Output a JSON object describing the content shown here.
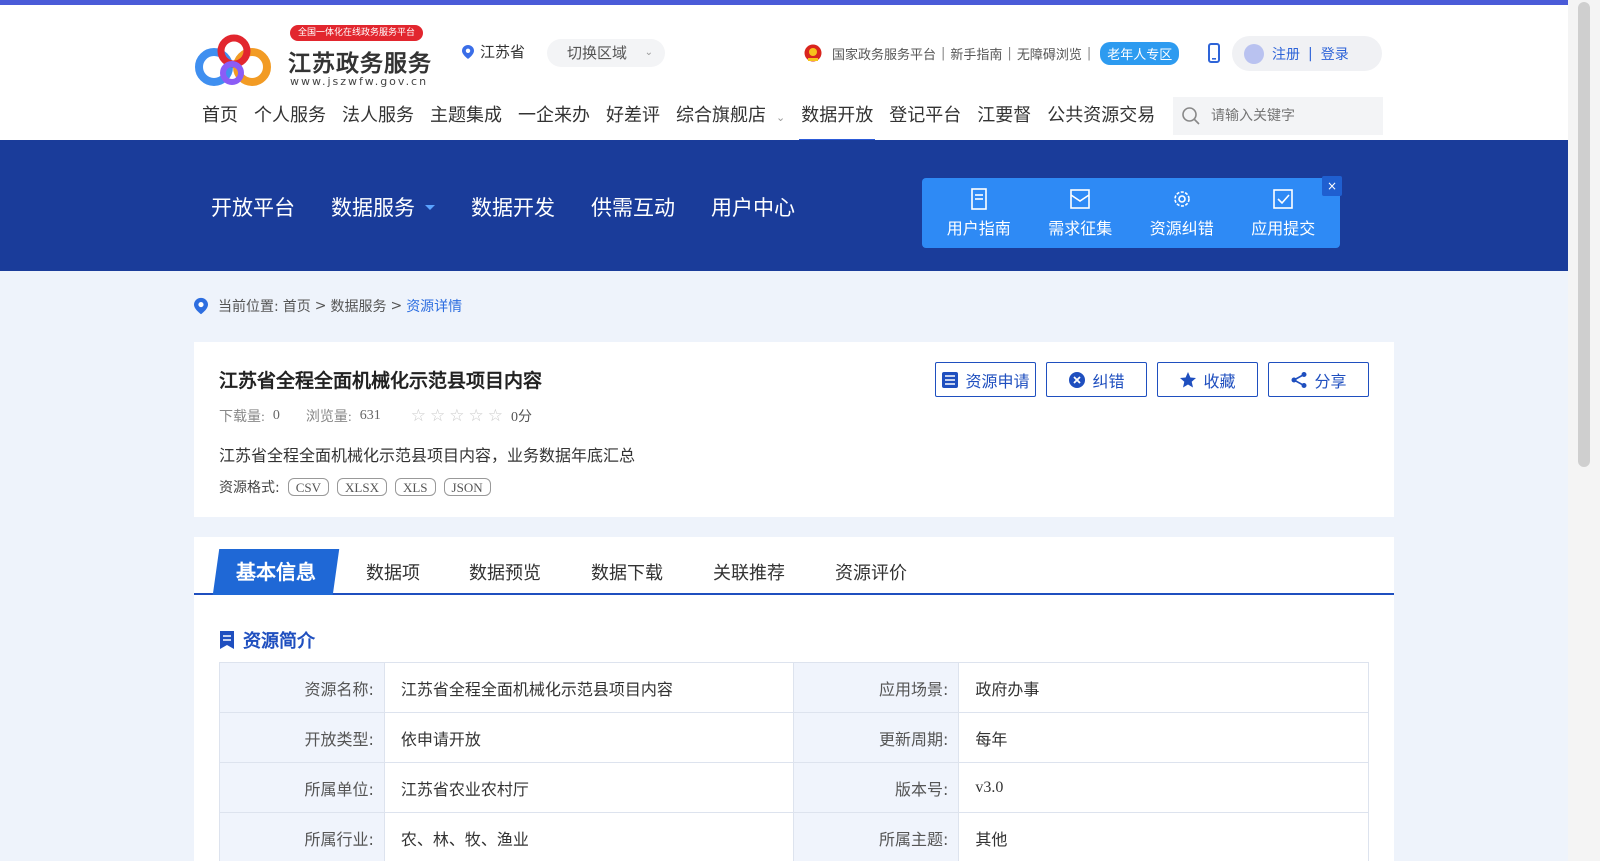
{
  "header": {
    "logo_badge": "全国一体化在线政务服务平台",
    "logo_title": "江苏政务服务",
    "logo_url": "www.jszwfw.gov.cn",
    "province": "江苏省",
    "switch_region": "切换区域",
    "links": [
      "国家政务服务平台",
      "新手指南",
      "无障碍浏览"
    ],
    "elder_zone": "老年人专区",
    "register": "注册",
    "login_sep": "|",
    "login": "登录",
    "search_placeholder": "请输入关键字"
  },
  "nav": {
    "items": [
      "首页",
      "个人服务",
      "法人服务",
      "主题集成",
      "一企来办",
      "好差评",
      "综合旗舰店",
      "数据开放",
      "登记平台",
      "江要督",
      "公共资源交易"
    ],
    "active": "数据开放"
  },
  "subnav": {
    "items": [
      "开放平台",
      "数据服务",
      "数据开发",
      "供需互动",
      "用户中心"
    ]
  },
  "quick": {
    "items": [
      "用户指南",
      "需求征集",
      "资源纠错",
      "应用提交"
    ],
    "close": "×"
  },
  "breadcrumb": {
    "label": "当前位置:",
    "home": "首页",
    "sep": ">",
    "level2": "数据服务",
    "current": "资源详情"
  },
  "resource": {
    "title": "江苏省全程全面机械化示范县项目内容",
    "downloads_label": "下载量:",
    "downloads": "0",
    "views_label": "浏览量:",
    "views": "631",
    "rating_stars": 0,
    "score": "0分",
    "description": "江苏省全程全面机械化示范县项目内容，业务数据年底汇总",
    "formats_label": "资源格式:",
    "formats": [
      "CSV",
      "XLSX",
      "XLS",
      "JSON"
    ],
    "actions": [
      "资源申请",
      "纠错",
      "收藏",
      "分享"
    ]
  },
  "tabs": {
    "active": "基本信息",
    "items": [
      "数据项",
      "数据预览",
      "数据下载",
      "关联推荐",
      "资源评价"
    ]
  },
  "intro": {
    "title": "资源简介",
    "rows": [
      {
        "k1": "资源名称:",
        "v1": "江苏省全程全面机械化示范县项目内容",
        "k2": "应用场景:",
        "v2": "政府办事"
      },
      {
        "k1": "开放类型:",
        "v1": "依申请开放",
        "k2": "更新周期:",
        "v2": "每年"
      },
      {
        "k1": "所属单位:",
        "v1": "江苏省农业农村厅",
        "k2": "版本号:",
        "v2": "v3.0"
      },
      {
        "k1": "所属行业:",
        "v1": "农、林、牧、渔业",
        "k2": "所属主题:",
        "v2": "其他"
      }
    ]
  },
  "colors": {
    "accent": "#1f4fbf",
    "banner": "#1a3c9a",
    "quick_panel": "#2e8af5",
    "top_line": "#4a5bd8",
    "badge_red": "#e2262e"
  }
}
